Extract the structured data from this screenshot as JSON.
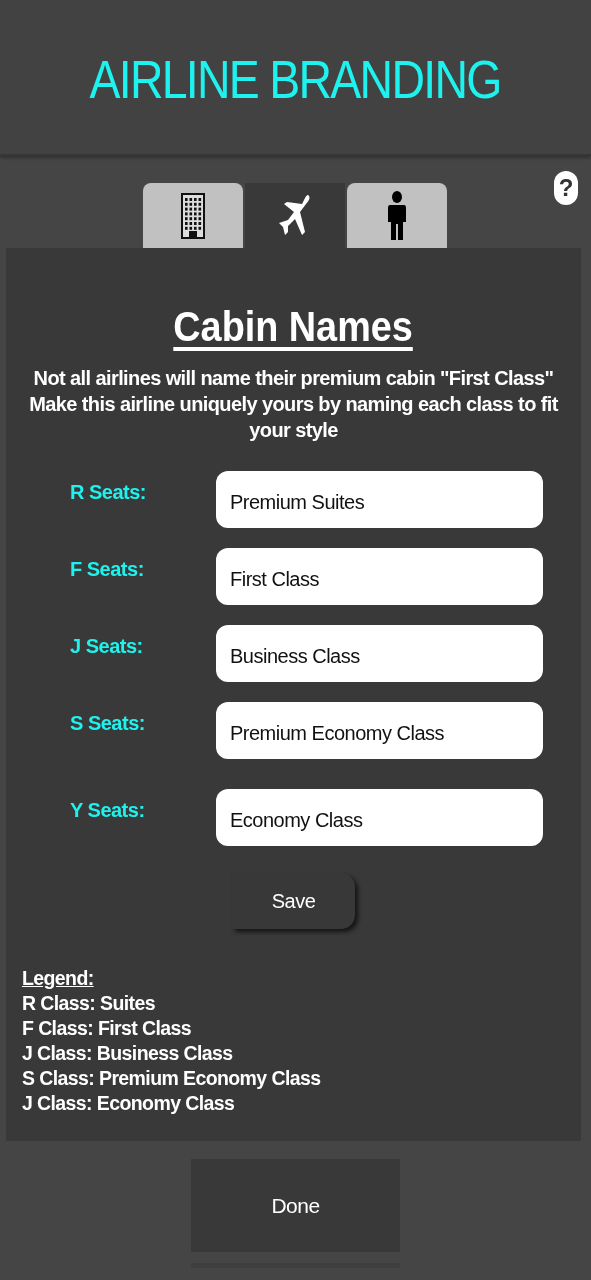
{
  "header": {
    "title": "AIRLINE BRANDING"
  },
  "tabs": [
    {
      "kind": "building",
      "selected": false
    },
    {
      "kind": "plane",
      "selected": true
    },
    {
      "kind": "person",
      "selected": false
    }
  ],
  "help": {
    "label": "?"
  },
  "panel": {
    "title": "Cabin Names",
    "description": "Not all airlines will name their premium cabin \"First Class\" Make this airline uniquely yours by naming each class to fit your style",
    "fields": [
      {
        "label": "R Seats:",
        "value": "Premium Suites"
      },
      {
        "label": "F Seats:",
        "value": "First Class"
      },
      {
        "label": "J Seats:",
        "value": "Business Class"
      },
      {
        "label": "S Seats:",
        "value": "Premium Economy Class"
      },
      {
        "label": "Y Seats:",
        "value": "Economy Class"
      }
    ],
    "save_button": "Save",
    "legend": {
      "heading": "Legend:",
      "lines": [
        "R Class: Suites",
        "F Class: First Class",
        "J Class: Business Class",
        "S Class: Premium Economy Class",
        "J Class: Economy Class"
      ]
    }
  },
  "done_button": "Done"
}
